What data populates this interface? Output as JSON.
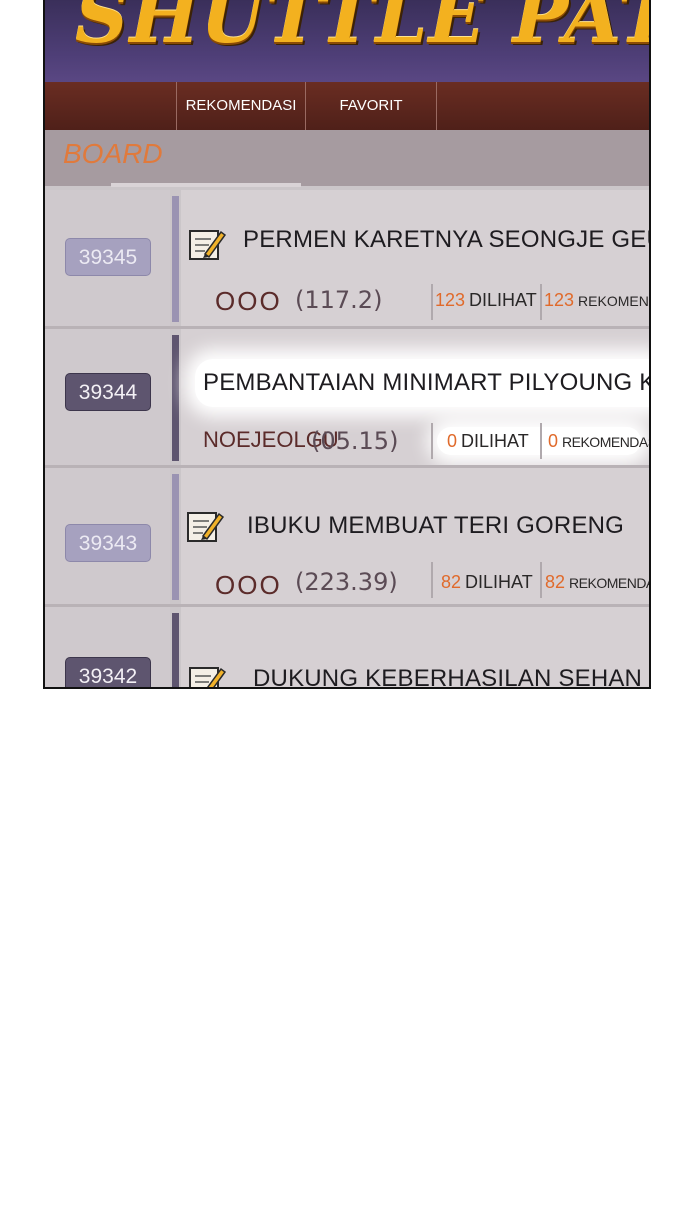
{
  "app": {
    "logo": "SHUTTLE PATCH"
  },
  "nav": {
    "items": [
      {
        "label": "REKOMENDASI"
      },
      {
        "label": "FAVORIT"
      }
    ]
  },
  "board": {
    "title": "BOARD"
  },
  "posts": [
    {
      "number": "39345",
      "title": "PERMEN KARETNYA SEONGJE GEUM",
      "author": "OOO",
      "date": "(117.2)",
      "views": "123",
      "views_label": "DILIHAT",
      "recs": "123",
      "recs_label": "REKOMENDASI",
      "style": "light"
    },
    {
      "number": "39344",
      "title": "PEMBANTAIAN MINIMART PILYOUNG K",
      "author": "NOEJEOLGU",
      "date": "(05.15)",
      "views": "0",
      "views_label": "DILIHAT",
      "recs": "0",
      "recs_label": "REKOMENDASI",
      "style": "dark"
    },
    {
      "number": "39343",
      "title": "IBUKU MEMBUAT TERI GORENG",
      "author": "OOO",
      "date": "(223.39)",
      "views": "82",
      "views_label": "DILIHAT",
      "recs": "82",
      "recs_label": "REKOMENDASI",
      "style": "light"
    },
    {
      "number": "39342",
      "title": "DUKUNG KEBERHASILAN SEHAN LE",
      "style": "dark"
    }
  ],
  "colors": {
    "accent_orange": "#e06a2b",
    "banner_purple": "#4f3f78",
    "nav_brown": "#5a241c",
    "logo_gold": "#f3b11f"
  }
}
